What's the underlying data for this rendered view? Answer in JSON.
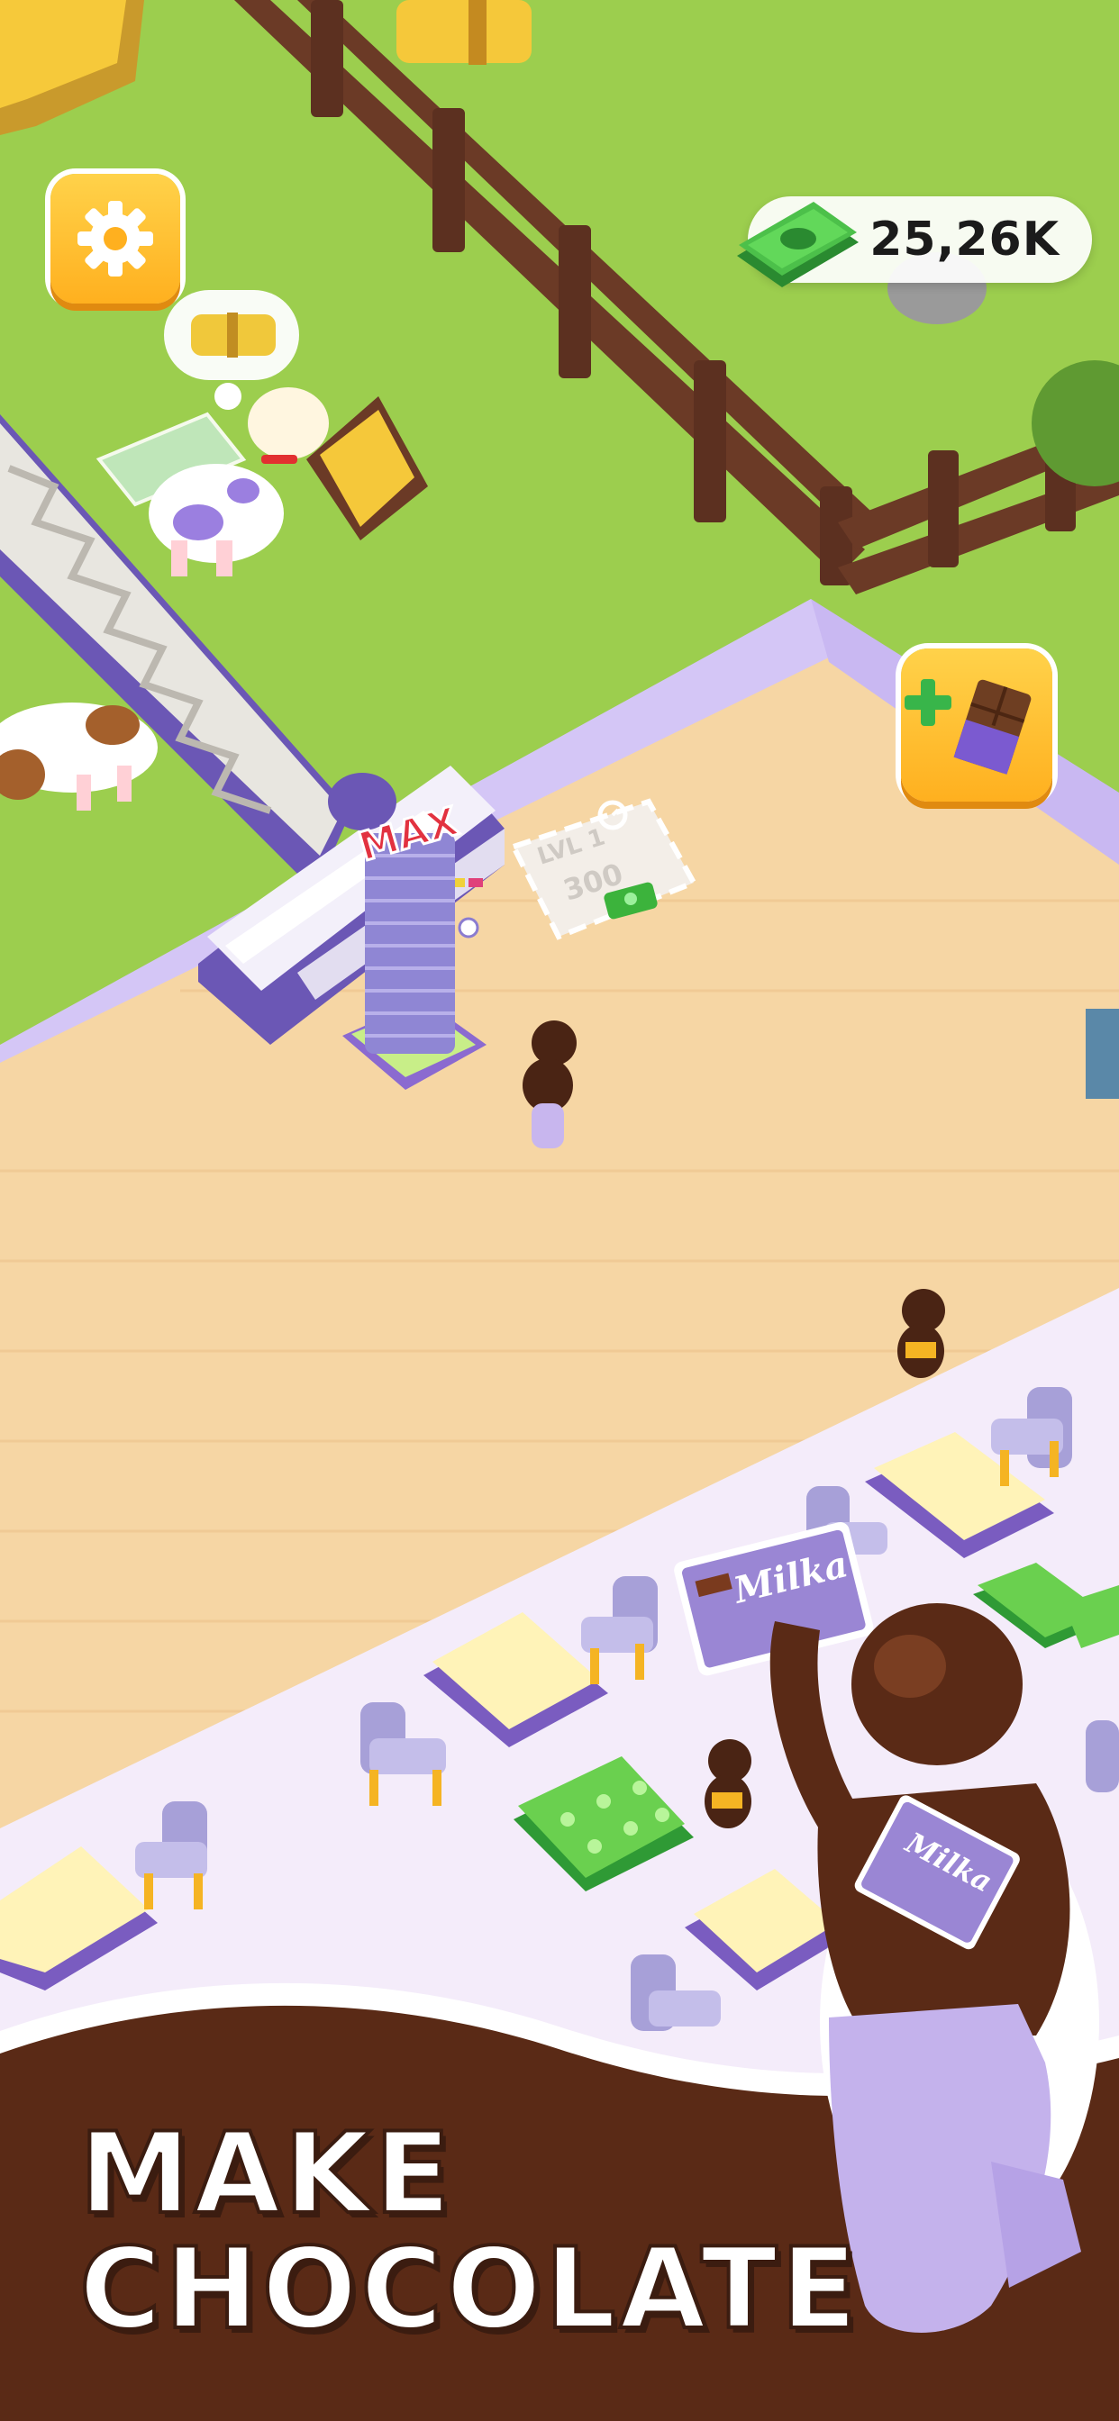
{
  "hud": {
    "money": "25,26K",
    "settings_icon": "gear-icon",
    "cash_icon": "cash-stack-icon",
    "add_chocolate_icon": "add-chocolate-icon"
  },
  "station": {
    "max_label": "MAX",
    "upgrade_level": "LVL 1",
    "upgrade_cost": "300"
  },
  "products": {
    "wrapper_label": "Milka"
  },
  "banner": {
    "line1": "MAKE",
    "line2": "CHOCOLATE"
  },
  "colors": {
    "grass": "#9cce4e",
    "floor": "#f6d6a4",
    "lavender": "#c9b8f2",
    "chocolate": "#5a2a16",
    "button_orange": "#ffb01f",
    "cash_green": "#3cb33c"
  }
}
